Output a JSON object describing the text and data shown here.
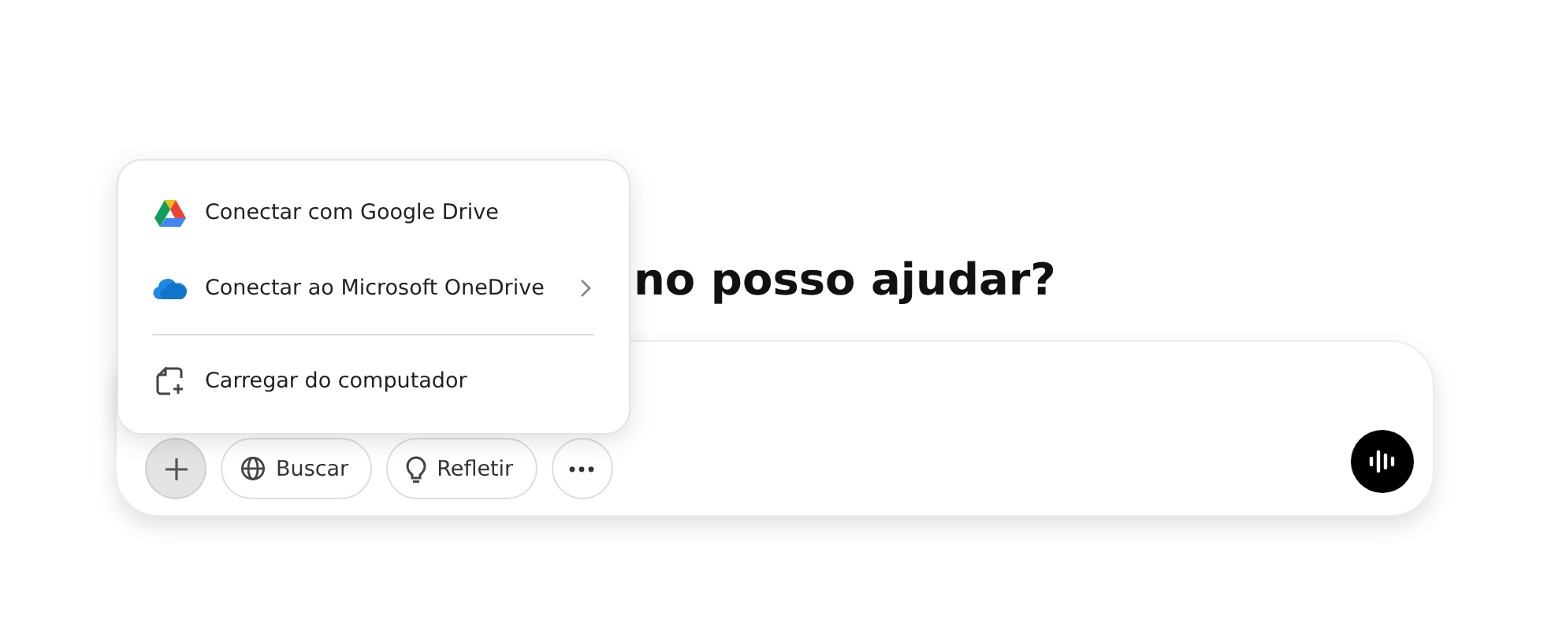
{
  "heading": "no posso ajudar?",
  "composer": {
    "attach_button": {
      "active": true
    },
    "tools": [
      {
        "kind": "search",
        "label": "Buscar"
      },
      {
        "kind": "think",
        "label": "Refletir"
      },
      {
        "kind": "more"
      }
    ]
  },
  "attach_menu": {
    "items": [
      {
        "kind": "google-drive",
        "label": "Conectar com Google Drive",
        "has_submenu": false
      },
      {
        "kind": "onedrive",
        "label": "Conectar ao Microsoft OneDrive",
        "has_submenu": true
      },
      {
        "kind": "divider"
      },
      {
        "kind": "upload",
        "label": "Carregar do computador",
        "has_submenu": false
      }
    ]
  }
}
